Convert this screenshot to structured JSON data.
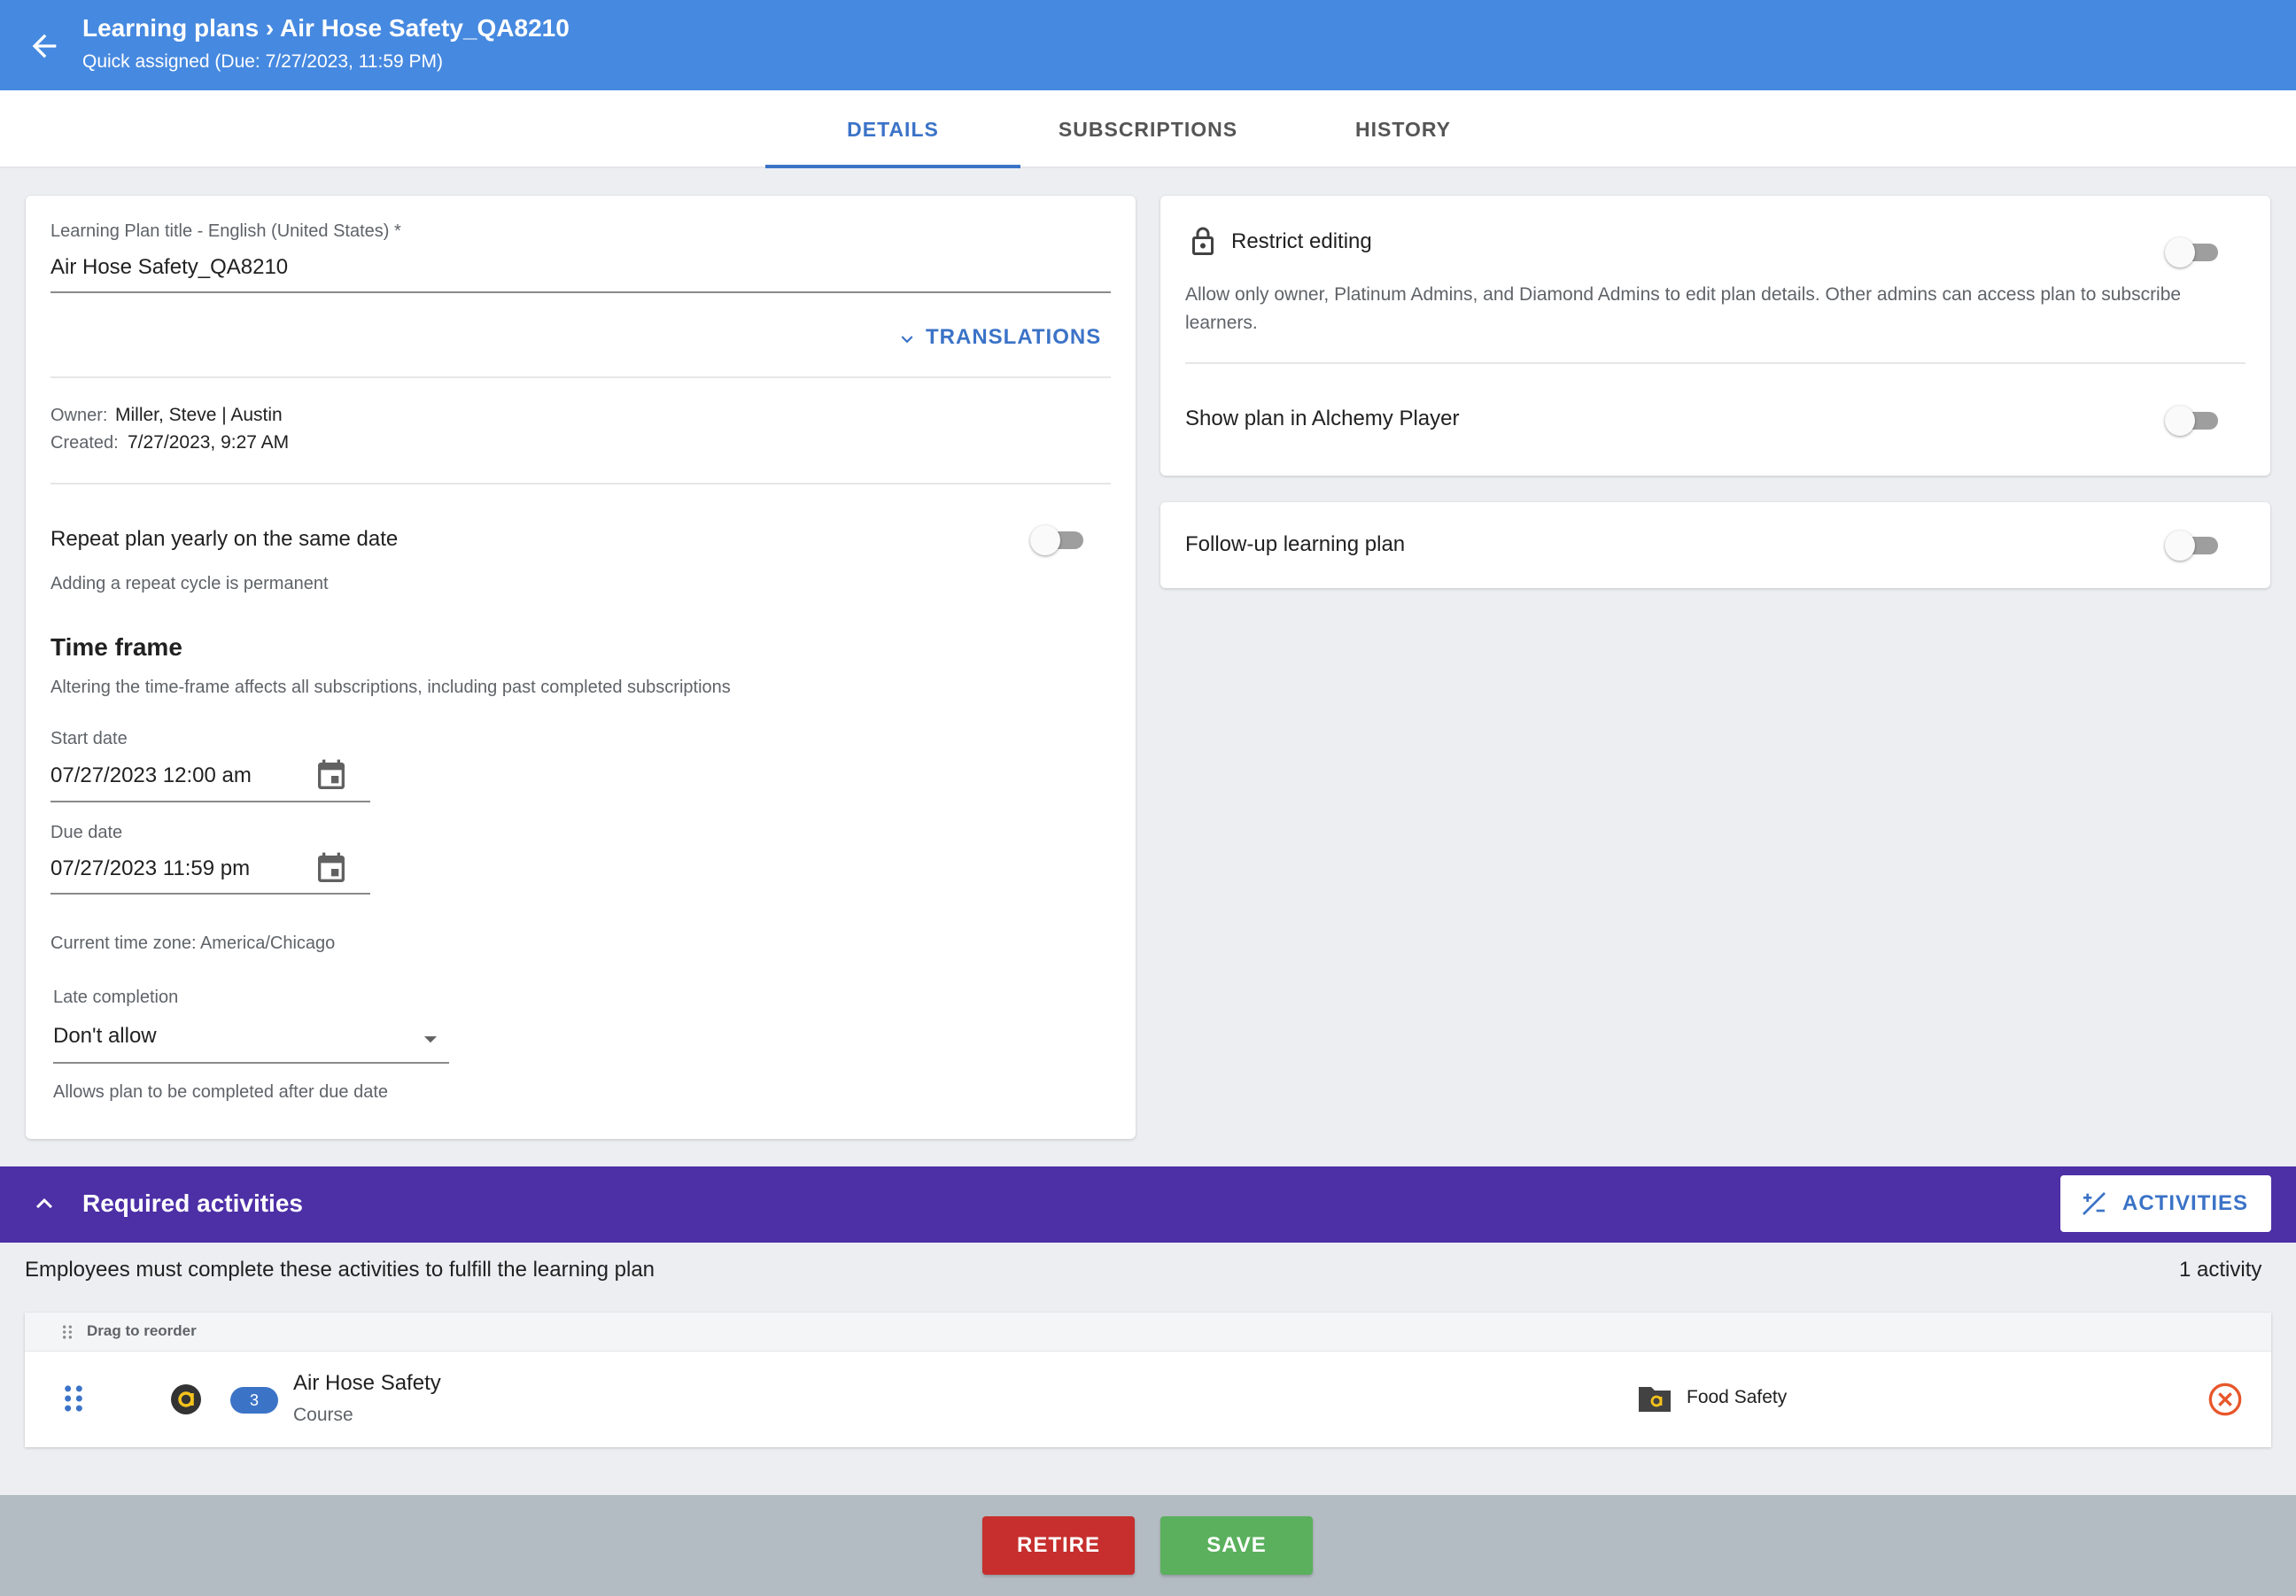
{
  "header": {
    "title": "Learning plans › Air Hose Safety_QA8210",
    "subtitle": "Quick assigned (Due: 7/27/2023, 11:59 PM)"
  },
  "tabs": [
    "DETAILS",
    "SUBSCRIPTIONS",
    "HISTORY"
  ],
  "details": {
    "title_label": "Learning Plan title - English (United States) *",
    "title_value": "Air Hose Safety_QA8210",
    "translations_label": "TRANSLATIONS",
    "owner_label": "Owner:",
    "owner_value": "Miller, Steve | Austin",
    "created_label": "Created:",
    "created_value": "7/27/2023, 9:27 AM",
    "repeat_label": "Repeat plan yearly on the same date",
    "repeat_on": false,
    "repeat_help": "Adding a repeat cycle is permanent",
    "timeframe_heading": "Time frame",
    "timeframe_help": "Altering the time-frame affects all subscriptions, including past completed subscriptions",
    "start_label": "Start date",
    "start_value": "07/27/2023 12:00 am",
    "due_label": "Due date",
    "due_value": "07/27/2023 11:59 pm",
    "timezone": "Current time zone: America/Chicago",
    "late_label": "Late completion",
    "late_value": "Don't allow",
    "late_help": "Allows plan to be completed after due date"
  },
  "settings": {
    "restrict_label": "Restrict editing",
    "restrict_on": false,
    "restrict_help": "Allow only owner, Platinum Admins, and Diamond Admins to edit plan details. Other admins can access plan to subscribe learners.",
    "show_player_label": "Show plan in Alchemy Player",
    "show_player_on": false,
    "followup_label": "Follow-up learning plan",
    "followup_on": false
  },
  "required": {
    "heading": "Required activities",
    "button_label": "ACTIVITIES",
    "description": "Employees must complete these activities to fulfill the learning plan",
    "count_text": "1 activity",
    "drag_label": "Drag to reorder",
    "items": [
      {
        "badge": "3",
        "title": "Air Hose Safety",
        "type": "Course",
        "folder": "Food Safety"
      }
    ]
  },
  "footer": {
    "retire_label": "RETIRE",
    "save_label": "SAVE"
  },
  "colors": {
    "header": "#4689e0",
    "accent": "#3b73c7",
    "required_bar": "#4d2fa6",
    "retire": "#c62f2d",
    "save": "#5ab05c",
    "remove_icon": "#e8572b"
  }
}
